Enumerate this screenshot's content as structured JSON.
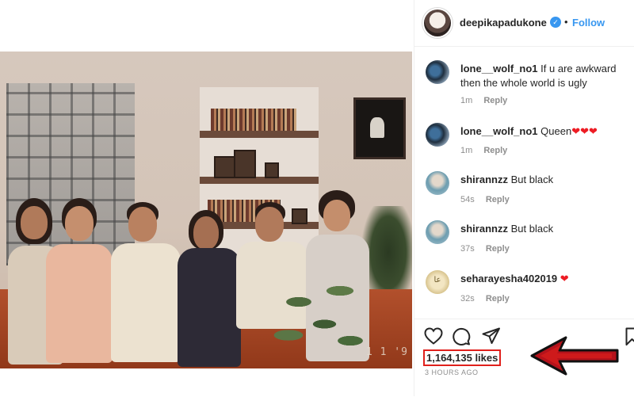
{
  "post": {
    "author": "deepikapadukone",
    "separator": "•",
    "follow_label": "Follow",
    "photo_date_stamp": "1 1 '9",
    "likes": "1,164,135 likes",
    "time_ago": "3 HOURS AGO"
  },
  "comments": [
    {
      "user": "lone__wolf_no1",
      "text": "If u are awkward then the whole world is ugly",
      "time": "1m",
      "reply": "Reply",
      "emoji": ""
    },
    {
      "user": "lone__wolf_no1",
      "text": "Queen",
      "time": "1m",
      "reply": "Reply",
      "emoji": "❤❤❤"
    },
    {
      "user": "shirannzz",
      "text": "But black",
      "time": "54s",
      "reply": "Reply",
      "emoji": ""
    },
    {
      "user": "shirannzz",
      "text": "But black",
      "time": "37s",
      "reply": "Reply",
      "emoji": ""
    },
    {
      "user": "seharayesha402019",
      "text": "",
      "time": "32s",
      "reply": "Reply",
      "emoji": "❤"
    }
  ],
  "avatar_glyphs": {
    "seharayesha": "ﻋﺎ"
  },
  "colors": {
    "accent_blue": "#3897f0",
    "annotation_red": "#e0201c",
    "heart_red": "#ed4956"
  },
  "icons": [
    "heart-icon",
    "comment-icon",
    "share-icon",
    "bookmark-icon",
    "verified-badge-icon",
    "annotation-arrow-icon"
  ]
}
